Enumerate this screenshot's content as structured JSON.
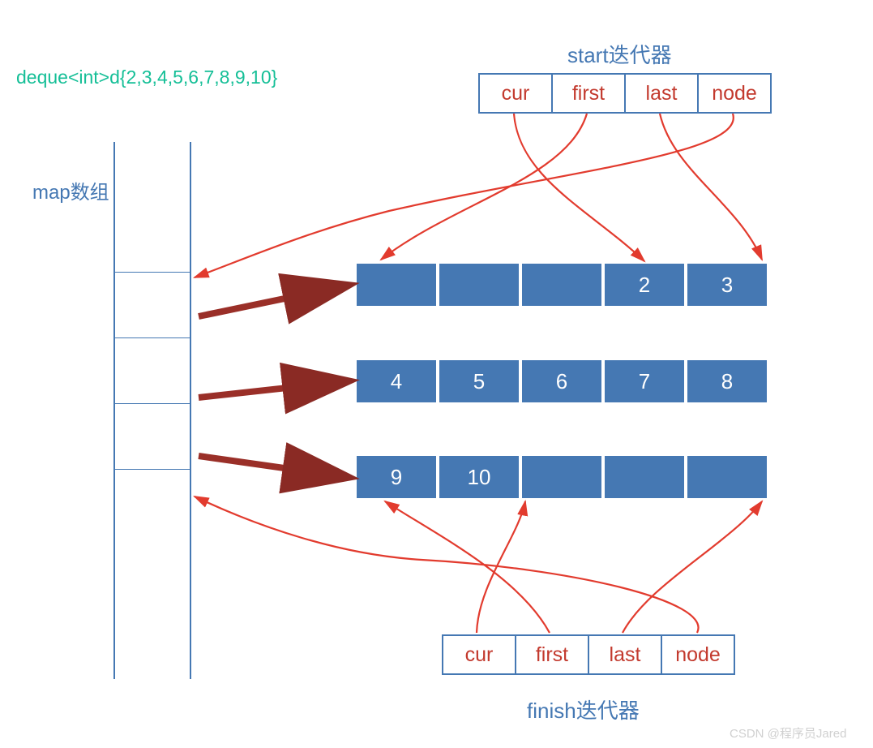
{
  "declaration": "deque<int>d{2,3,4,5,6,7,8,9,10}",
  "map_label": "map数组",
  "start_iter": {
    "title": "start迭代器",
    "fields": [
      "cur",
      "first",
      "last",
      "node"
    ]
  },
  "finish_iter": {
    "title": "finish迭代器",
    "fields": [
      "cur",
      "first",
      "last",
      "node"
    ]
  },
  "buffers": {
    "row1": [
      "",
      "",
      "",
      "2",
      "3"
    ],
    "row2": [
      "4",
      "5",
      "6",
      "7",
      "8"
    ],
    "row3": [
      "9",
      "10",
      "",
      "",
      ""
    ]
  },
  "watermark": "CSDN @程序员Jared"
}
